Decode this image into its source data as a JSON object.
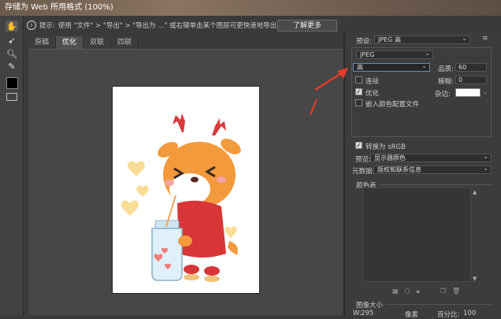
{
  "window": {
    "title": "存储为 Web 所用格式 (100%)"
  },
  "hint": {
    "prefix": "提示:",
    "text": "使用 \"文件\" > \"导出\" > \"导出为 ...\" 或右键单击某个图层可更快速地导出资源",
    "learn_more": "了解更多"
  },
  "tabs": [
    "原稿",
    "优化",
    "双联",
    "四联"
  ],
  "active_tab": 1,
  "panel": {
    "preset_label": "预设:",
    "preset_value": "JPEG 高",
    "format_value": "JPEG",
    "quality_preset_value": "高",
    "quality_label": "品质:",
    "quality_value": "60",
    "progressive_label": "连续",
    "blur_label": "模糊:",
    "blur_value": "0",
    "optimized_label": "优化",
    "matte_label": "杂边:",
    "embed_profile_label": "嵌入颜色配置文件",
    "convert_srgb_label": "转换为 sRGB",
    "preview_label": "预览:",
    "preview_value": "显示器颜色",
    "metadata_label": "元数据:",
    "metadata_value": "版权和联系信息",
    "color_table_label": "颜色表",
    "image_size_label": "图像大小",
    "w_value": "295",
    "w_unit": "像素",
    "percent_label": "百分比:",
    "percent_value": "100"
  },
  "checks": {
    "progressive": false,
    "optimized": true,
    "embed_profile": false,
    "convert_srgb": true
  },
  "colors": {
    "arrow": "#e63a2a",
    "accent": "#6a8ab0"
  }
}
